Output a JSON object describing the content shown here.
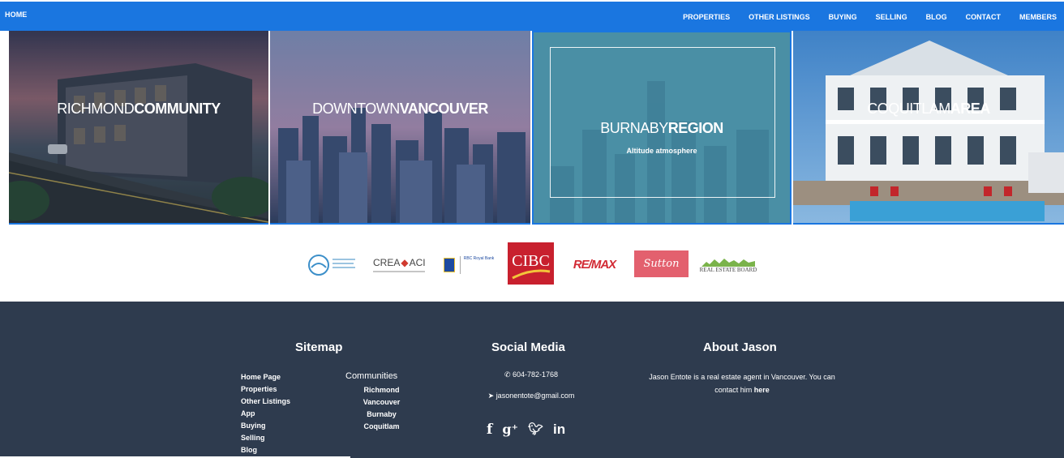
{
  "nav": {
    "home": "HOME",
    "links": [
      "PROPERTIES",
      "OTHER LISTINGS",
      "BUYING",
      "SELLING",
      "BLOG",
      "CONTACT",
      "MEMBERS"
    ]
  },
  "tiles": [
    {
      "light": "RICHMOND",
      "bold": "COMMUNITY"
    },
    {
      "light": "DOWNTOWN",
      "bold": "VANCOUVER"
    },
    {
      "light": "BURNABY",
      "bold": "REGION",
      "subtitle": "Altitude atmosphere"
    },
    {
      "light": "COQUITLAM",
      "bold": "AREA"
    }
  ],
  "partners": {
    "crea": "CREA",
    "aci": "ACI",
    "rbc": "RBC Royal Bank",
    "cibc": "CIBC",
    "remax": "RE/MAX",
    "sutton": "Sutton",
    "board": "REAL ESTATE BOARD"
  },
  "footer": {
    "sitemap": {
      "title": "Sitemap",
      "items": [
        "Home Page",
        "Properties",
        "Other Listings",
        "App",
        "Buying",
        "Selling",
        "Blog"
      ],
      "communities_title": "Communities",
      "communities": [
        "Richmond",
        "Vancouver",
        "Burnaby",
        "Coquitlam"
      ]
    },
    "social": {
      "title": "Social Media",
      "phone": "604-782-1768",
      "email": "jasonentote@gmail.com",
      "icons": [
        "facebook-icon",
        "google-plus-icon",
        "twitter-icon",
        "linkedin-icon"
      ]
    },
    "about": {
      "title": "About Jason",
      "text": "Jason Entote is a real estate agent in Vancouver. You can contact him",
      "link": "here"
    }
  },
  "colors": {
    "nav": "#1a76e0",
    "footer": "#2e3b4e",
    "burnaby_overlay": "#4a8fa5"
  }
}
